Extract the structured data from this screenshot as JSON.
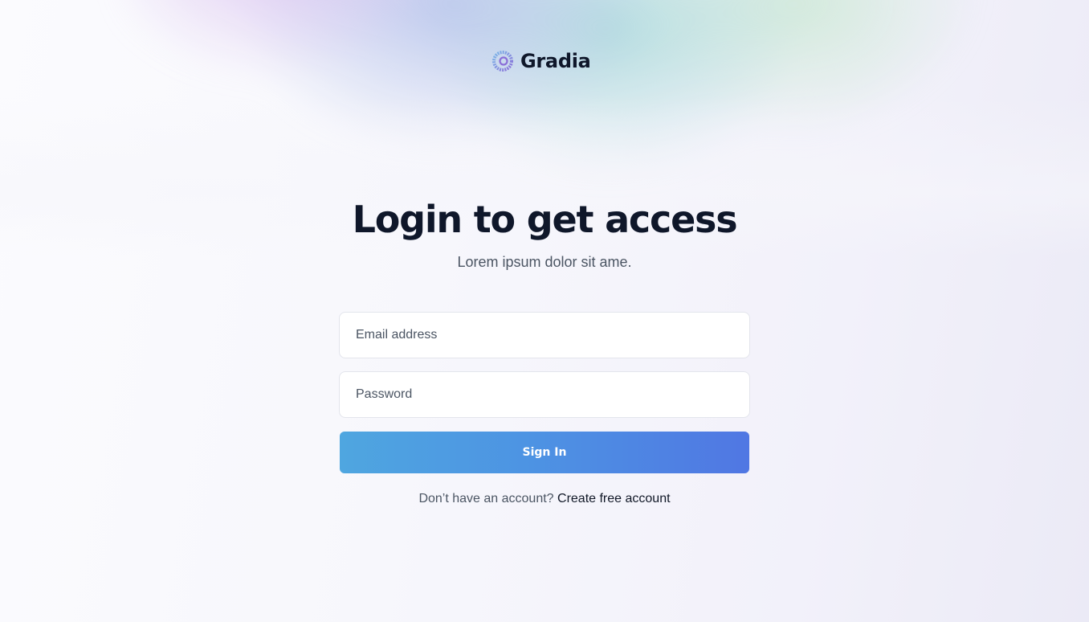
{
  "brand": {
    "name": "Gradia",
    "logo_icon": "gradient-ring-icon",
    "colors": {
      "ring_start": "#7ab7e8",
      "ring_end": "#8b6fd8",
      "primary_button_start": "#4fa6e0",
      "primary_button_end": "#5077e3"
    }
  },
  "login": {
    "title": "Login to get access",
    "subtitle": "Lorem ipsum dolor sit ame.",
    "email": {
      "placeholder": "Email address",
      "value": ""
    },
    "password": {
      "placeholder": "Password",
      "value": ""
    },
    "submit_label": "Sign In",
    "signup_prompt": "Don’t have an account?",
    "signup_link": "Create free account"
  }
}
